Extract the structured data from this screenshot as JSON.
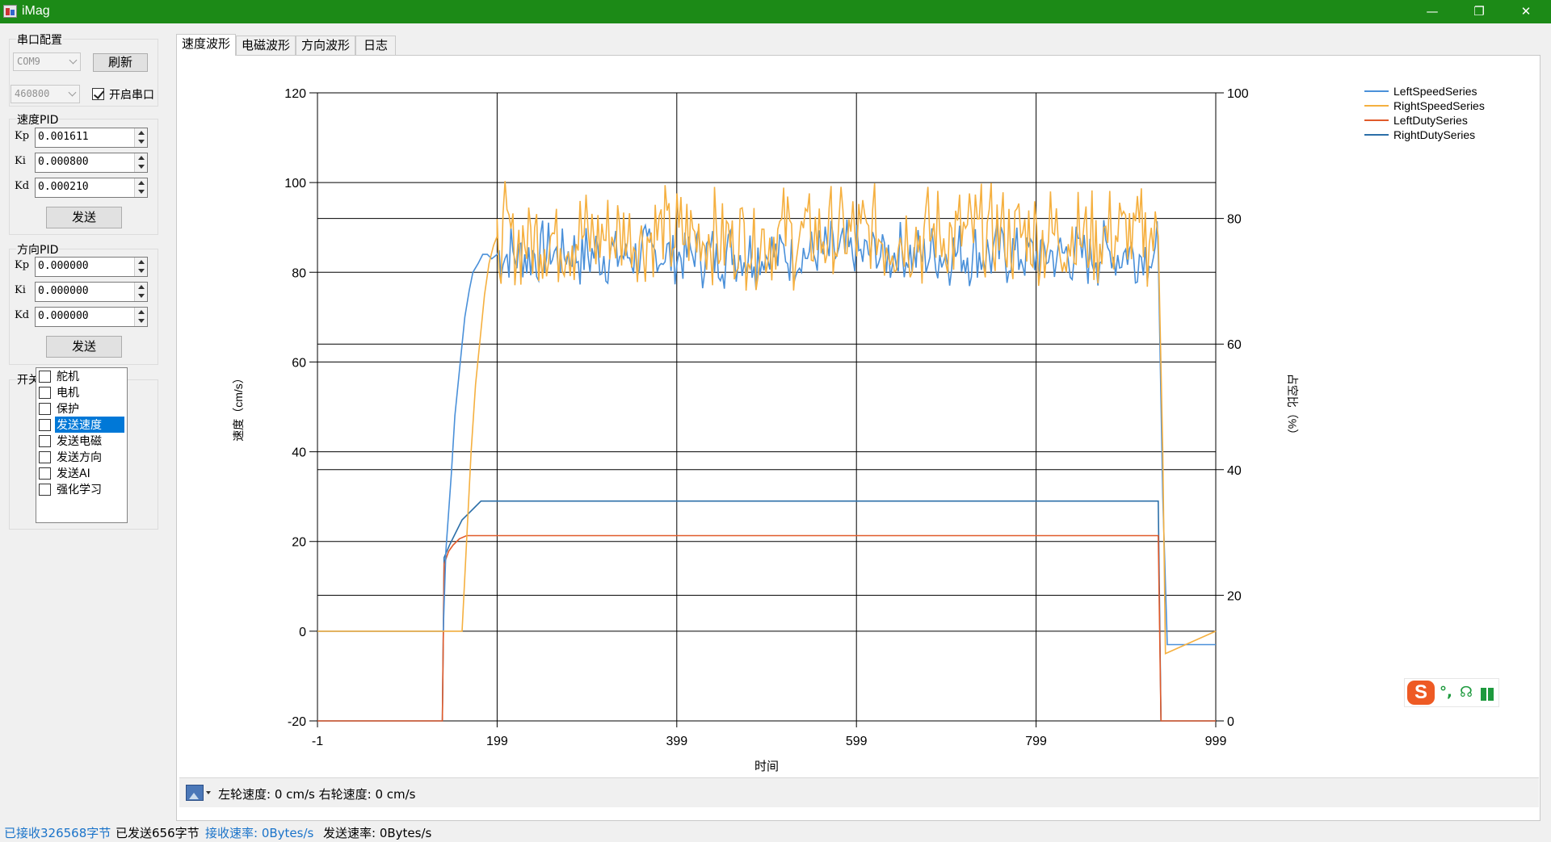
{
  "window": {
    "title": "iMag",
    "minimize": "—",
    "restore": "❐",
    "close": "✕"
  },
  "serial": {
    "group_label": "串口配置",
    "port_value": "COM9",
    "refresh_label": "刷新",
    "baud_value": "460800",
    "open_label": "开启串口",
    "open_checked": true
  },
  "speed_pid": {
    "group_label": "速度PID",
    "fields": [
      {
        "label": "Kp",
        "value": "0.001611"
      },
      {
        "label": "Ki",
        "value": "0.000800"
      },
      {
        "label": "Kd",
        "value": "0.000210"
      }
    ],
    "send_label": "发送"
  },
  "dir_pid": {
    "group_label": "方向PID",
    "fields": [
      {
        "label": "Kp",
        "value": "0.000000"
      },
      {
        "label": "Ki",
        "value": "0.000000"
      },
      {
        "label": "Kd",
        "value": "0.000000"
      }
    ],
    "send_label": "发送"
  },
  "switches": {
    "group_label": "开关",
    "items": [
      {
        "label": "舵机",
        "checked": false,
        "selected": false
      },
      {
        "label": "电机",
        "checked": false,
        "selected": false
      },
      {
        "label": "保护",
        "checked": false,
        "selected": false
      },
      {
        "label": "发送速度",
        "checked": false,
        "selected": true
      },
      {
        "label": "发送电磁",
        "checked": false,
        "selected": false
      },
      {
        "label": "发送方向",
        "checked": false,
        "selected": false
      },
      {
        "label": "发送AI",
        "checked": false,
        "selected": false
      },
      {
        "label": "强化学习",
        "checked": false,
        "selected": false
      }
    ]
  },
  "tabs": [
    {
      "label": "速度波形",
      "active": true
    },
    {
      "label": "电磁波形",
      "active": false
    },
    {
      "label": "方向波形",
      "active": false
    },
    {
      "label": "日志",
      "active": false
    }
  ],
  "chart_data": {
    "type": "line",
    "xlabel": "时间",
    "ylabel": "速度（cm/s）",
    "y2label": "占空比（%）",
    "xlim": [
      -1,
      999
    ],
    "ylim": [
      -20,
      120
    ],
    "y2lim": [
      0,
      100
    ],
    "x_ticks": [
      -1,
      199,
      399,
      599,
      799,
      999
    ],
    "y_ticks": [
      -20,
      0,
      20,
      40,
      60,
      80,
      100,
      120
    ],
    "y2_ticks": [
      0,
      20,
      40,
      60,
      80,
      100
    ],
    "grid": true,
    "legend_position": "top-right",
    "series": [
      {
        "name": "LeftSpeedSeries",
        "color": "#4a90d9",
        "axis": "left",
        "segments": [
          {
            "x": [
              -1,
              139
            ],
            "y": [
              0,
              0
            ]
          },
          {
            "x": [
              139,
              142,
              148,
              152,
              158,
              163,
              168,
              172,
              178,
              183,
              188,
              193,
              199
            ],
            "y": [
              0,
              18,
              35,
              48,
              60,
              70,
              76,
              80,
              82,
              84,
              84,
              83,
              84
            ]
          },
          {
            "x": [
              199,
              935
            ],
            "y_mean": 84,
            "y_min": 76,
            "y_max": 92
          },
          {
            "x": [
              935,
              940,
              945,
              1000
            ],
            "y": [
              84,
              30,
              -3,
              -3
            ]
          }
        ]
      },
      {
        "name": "RightSpeedSeries",
        "color": "#f5b040",
        "axis": "left",
        "segments": [
          {
            "x": [
              -1,
              160
            ],
            "y": [
              0,
              0
            ]
          },
          {
            "x": [
              160,
              165,
              170,
              175,
              180,
              185,
              190,
              195,
              199
            ],
            "y": [
              0,
              20,
              40,
              55,
              65,
              75,
              82,
              86,
              88
            ]
          },
          {
            "x": [
              199,
              935
            ],
            "y_mean": 88,
            "y_min": 76,
            "y_max": 101
          },
          {
            "x": [
              935,
              940,
              943,
              1000
            ],
            "y": [
              88,
              40,
              -5,
              0
            ]
          }
        ]
      },
      {
        "name": "LeftDutySeries",
        "color": "#e05a2a",
        "axis": "right",
        "segments": [
          {
            "x": [
              -1,
              138
            ],
            "y": [
              0,
              0
            ]
          },
          {
            "x": [
              138,
              140,
              145,
              150,
              157,
              165,
              935,
              938,
              1000
            ],
            "y": [
              0,
              25,
              27,
              28,
              29,
              29.5,
              29.5,
              0,
              0
            ]
          }
        ]
      },
      {
        "name": "RightDutySeries",
        "color": "#2c6fa8",
        "axis": "right",
        "segments": [
          {
            "x": [
              -1,
              138
            ],
            "y": [
              0,
              0
            ]
          },
          {
            "x": [
              138,
              140,
              146,
              153,
              160,
              167,
              174,
              181,
              190,
              935,
              938,
              1000
            ],
            "y": [
              0,
              26,
              28,
              30,
              32,
              33,
              34,
              35,
              35,
              35,
              0,
              0
            ]
          }
        ]
      }
    ]
  },
  "chart_footer": {
    "text": "左轮速度: 0 cm/s  右轮速度: 0 cm/s"
  },
  "status": {
    "received": "已接收326568字节",
    "sent": "已发送656字节",
    "rx_rate": "接收速率: 0Bytes/s",
    "tx_rate": "发送速率: 0Bytes/s"
  },
  "ime": {
    "logo": "S",
    "punct": "°,",
    "voice": "☊"
  }
}
